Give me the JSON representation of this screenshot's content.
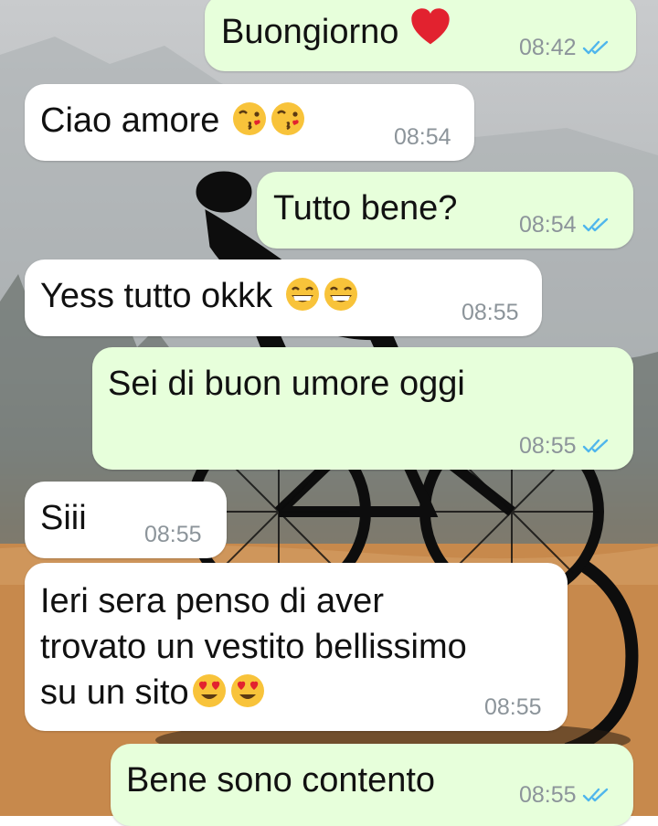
{
  "chat": {
    "messages": [
      {
        "direction": "outgoing",
        "text": "Buongiorno",
        "emoji": [
          "red-heart"
        ],
        "time": "08:42",
        "status": "read"
      },
      {
        "direction": "incoming",
        "text": "Ciao amore",
        "emoji": [
          "face-blowing-kiss",
          "face-blowing-kiss"
        ],
        "time": "08:54"
      },
      {
        "direction": "outgoing",
        "text": "Tutto bene?",
        "time": "08:54",
        "status": "read"
      },
      {
        "direction": "incoming",
        "text": "Yess tutto okkk",
        "emoji": [
          "beaming-face",
          "beaming-face"
        ],
        "time": "08:55"
      },
      {
        "direction": "outgoing",
        "text": "Sei di buon umore oggi",
        "time": "08:55",
        "status": "read"
      },
      {
        "direction": "incoming",
        "text": "Siii",
        "time": "08:55"
      },
      {
        "direction": "incoming",
        "lines": [
          "Ieri sera penso di aver",
          "trovato un vestito bellissimo",
          "su un sito"
        ],
        "emoji": [
          "heart-eyes",
          "heart-eyes"
        ],
        "time": "08:55"
      },
      {
        "direction": "outgoing",
        "text": "Bene sono contento",
        "time": "08:55",
        "status": "read"
      }
    ]
  },
  "colors": {
    "outgoing_bubble": "#e7ffdb",
    "incoming_bubble": "#ffffff",
    "read_ticks": "#4fb6ec",
    "timestamp": "#8c949a"
  }
}
